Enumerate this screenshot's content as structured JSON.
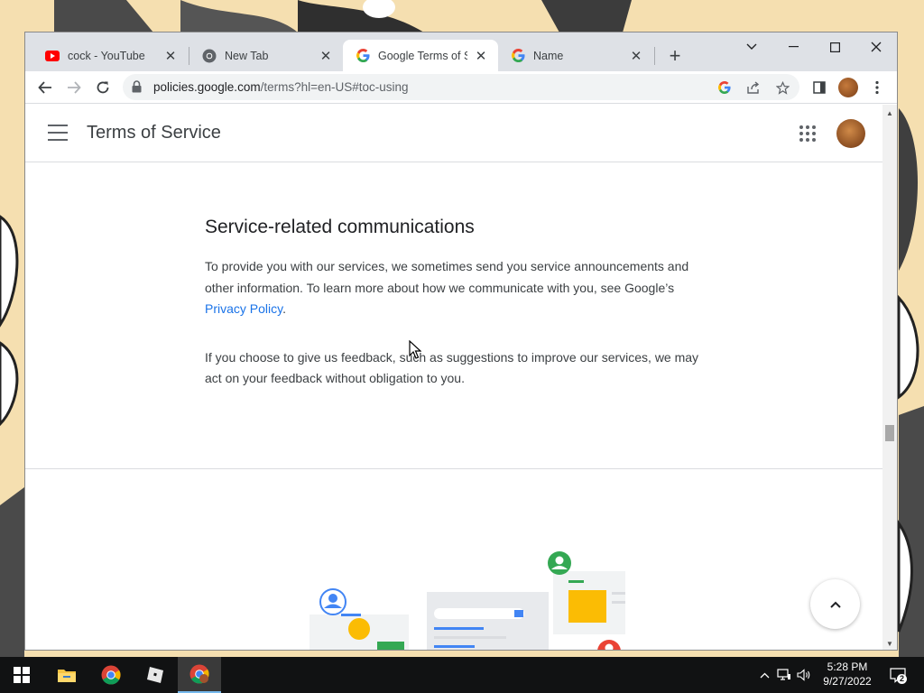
{
  "browser": {
    "tabs": [
      {
        "title": "cock - YouTube",
        "favicon": "youtube-icon",
        "active": false
      },
      {
        "title": "New Tab",
        "favicon": "chrome-icon",
        "active": false
      },
      {
        "title": "Google Terms of Ser",
        "favicon": "google-icon",
        "active": true
      },
      {
        "title": "Name",
        "favicon": "google-icon",
        "active": false
      }
    ],
    "url_host": "policies.google.com",
    "url_path": "/terms?hl=en-US#toc-using"
  },
  "page": {
    "site_title": "Terms of Service",
    "section_heading": "Service-related communications",
    "para1_text": "To provide you with our services, we sometimes send you service announcements and other information. To learn more about how we communicate with you, see Google’s ",
    "para1_link": "Privacy Policy",
    "para1_end": ".",
    "para2_text": "If you choose to give us feedback, such as suggestions to improve our services, we may act on your feedback without obligation to you."
  },
  "taskbar": {
    "time": "5:28 PM",
    "date": "9/27/2022",
    "notification_count": "2"
  },
  "colors": {
    "accent_link": "#1a73e8",
    "tabstrip": "#dee1e6",
    "taskbar": "#111213"
  }
}
